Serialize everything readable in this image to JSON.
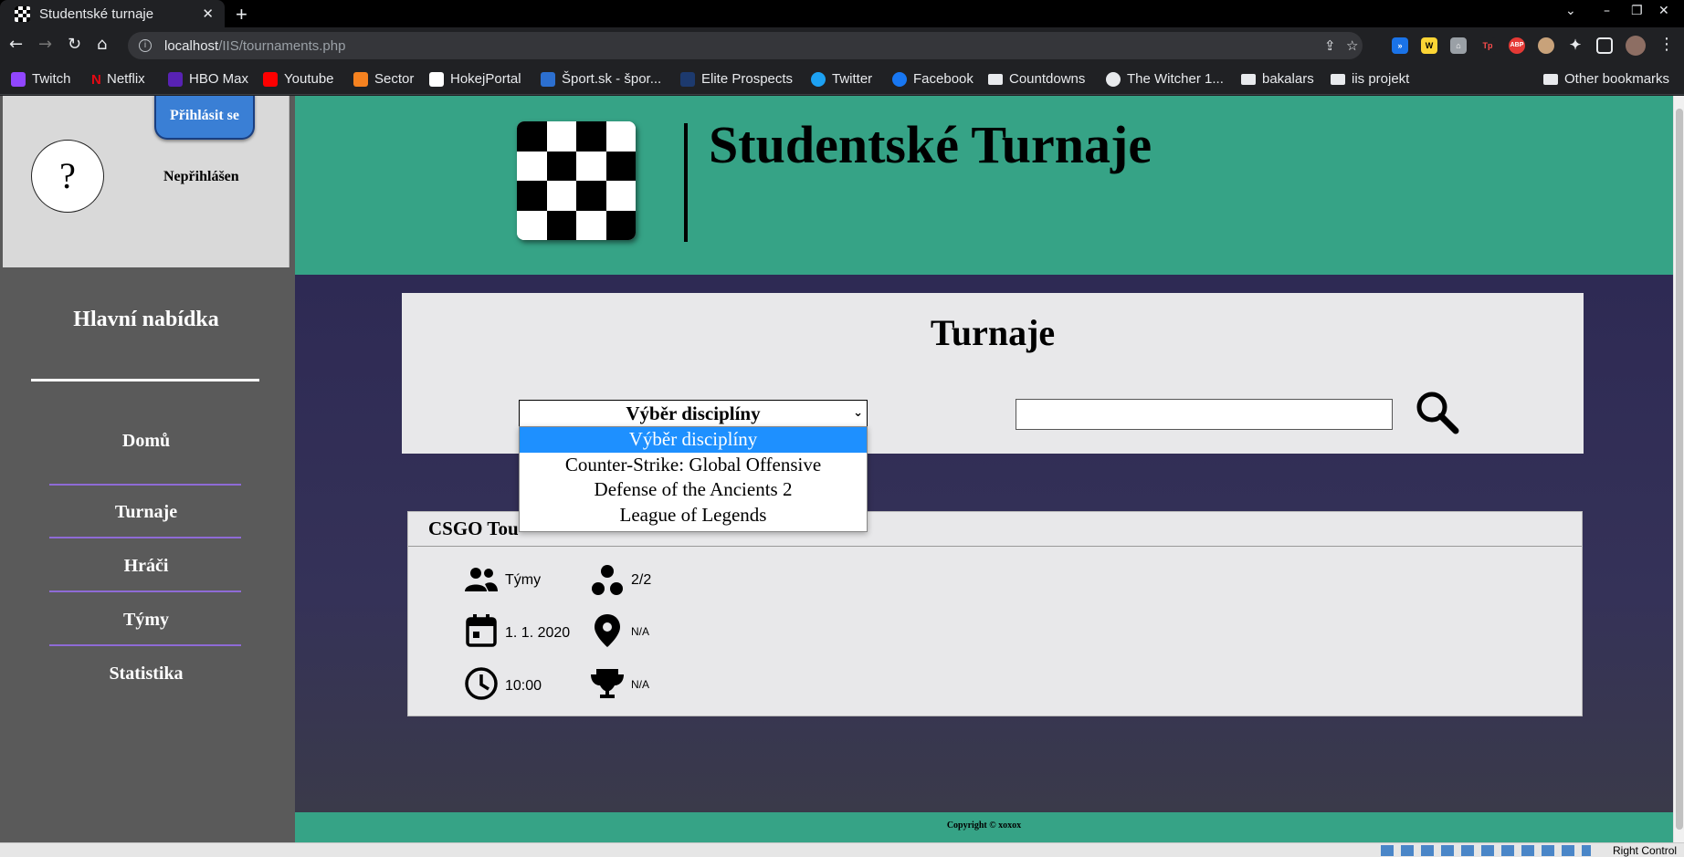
{
  "browser": {
    "tab_title": "Studentské turnaje",
    "url_host": "localhost",
    "url_path": "/IIS/tournaments.php",
    "bookmarks": [
      "Twitch",
      "Netflix",
      "HBO Max",
      "Youtube",
      "Sector",
      "HokejPortal",
      "Šport.sk - špor...",
      "Elite Prospects",
      "Twitter",
      "Facebook",
      "Countdowns",
      "The Witcher 1...",
      "bakalars",
      "iis projekt",
      "Other bookmarks"
    ],
    "ext_labels": [
      "W",
      "Tp",
      "ABP"
    ]
  },
  "sidebar": {
    "avatar_symbol": "?",
    "login_label": "Přihlásit se",
    "user_status": "Nepřihlášen",
    "menu_title": "Hlavní nabídka",
    "items": [
      {
        "label": "Domů"
      },
      {
        "label": "Turnaje"
      },
      {
        "label": "Hráči"
      },
      {
        "label": "Týmy"
      },
      {
        "label": "Statistika"
      }
    ]
  },
  "header": {
    "site_title": "Studentské Turnaje"
  },
  "search": {
    "page_title": "Turnaje",
    "discipline_selected": "Výběr disciplíny",
    "discipline_options": [
      "Výběr disciplíny",
      "Counter-Strike: Global Offensive",
      "Defense of the Ancients 2",
      "League of Legends"
    ],
    "query": ""
  },
  "tournament": {
    "title": "CSGO Tou",
    "type": "Týmy",
    "slots": "2/2",
    "date": "1. 1. 2020",
    "location": "N/A",
    "time": "10:00",
    "prize": "N/A"
  },
  "footer": {
    "copyright": "Copyright © xoxox"
  },
  "taskbar": {
    "host_key": "Right Control"
  },
  "colors": {
    "header_teal": "#36a386",
    "sidebar_gray": "#5a5a5a",
    "main_purple": "#2e2a54",
    "login_blue": "#3a7fd5",
    "option_highlight": "#1e90ff",
    "menu_separator": "#8e6bd6"
  }
}
